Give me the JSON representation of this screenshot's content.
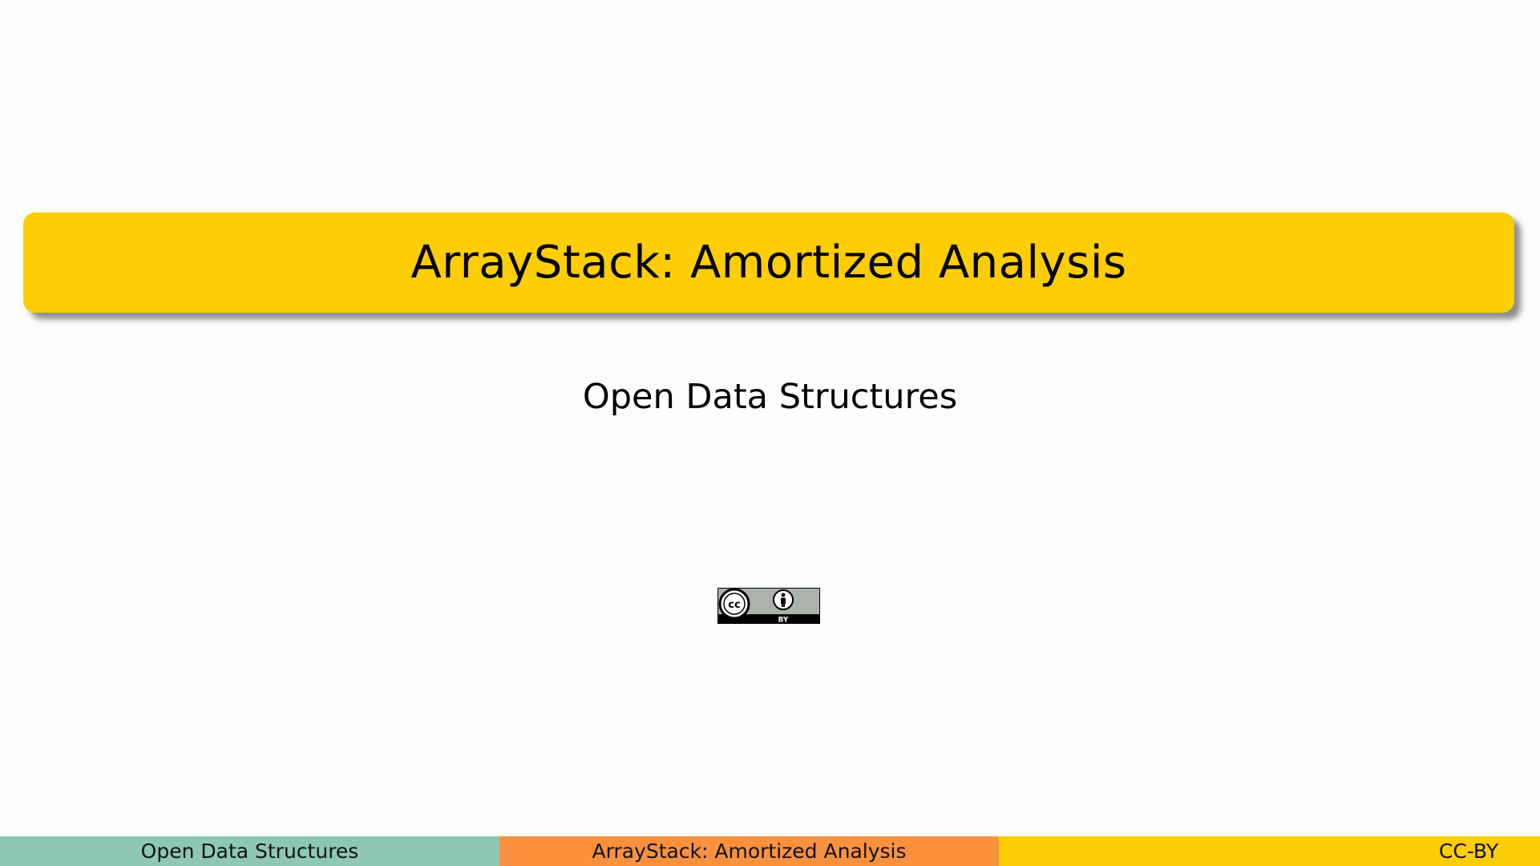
{
  "slide": {
    "title": "ArrayStack: Amortized Analysis",
    "subtitle": "Open Data Structures",
    "license_badge": {
      "cc_text": "cc",
      "by_text": "BY",
      "icons": [
        "creative-commons-icon",
        "attribution-person-icon"
      ]
    }
  },
  "footer": {
    "left": "Open Data Structures",
    "center": "ArrayStack: Amortized Analysis",
    "right": "CC-BY"
  },
  "colors": {
    "title_band": "#fdcd06",
    "footer_left": "#8fc7b7",
    "footer_center": "#f9913f",
    "footer_right": "#fdcd06"
  }
}
